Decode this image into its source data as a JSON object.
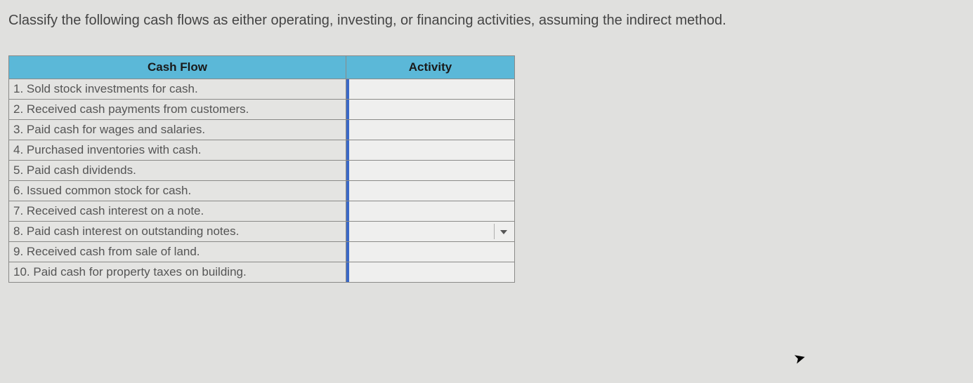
{
  "question": "Classify the following cash flows as either operating, investing, or financing activities, assuming the indirect method.",
  "headers": {
    "cash_flow": "Cash Flow",
    "activity": "Activity"
  },
  "rows": [
    {
      "desc": "1. Sold stock investments for cash.",
      "value": "",
      "arrow": false
    },
    {
      "desc": "2. Received cash payments from customers.",
      "value": "",
      "arrow": false
    },
    {
      "desc": "3. Paid cash for wages and salaries.",
      "value": "",
      "arrow": false
    },
    {
      "desc": "4. Purchased inventories with cash.",
      "value": "",
      "arrow": false
    },
    {
      "desc": "5. Paid cash dividends.",
      "value": "",
      "arrow": false
    },
    {
      "desc": "6. Issued common stock for cash.",
      "value": "",
      "arrow": false
    },
    {
      "desc": "7. Received cash interest on a note.",
      "value": "",
      "arrow": false
    },
    {
      "desc": "8. Paid cash interest on outstanding notes.",
      "value": "",
      "arrow": true
    },
    {
      "desc": "9. Received cash from sale of land.",
      "value": "",
      "arrow": false
    },
    {
      "desc": "10. Paid cash for property taxes on building.",
      "value": "",
      "arrow": false
    }
  ]
}
